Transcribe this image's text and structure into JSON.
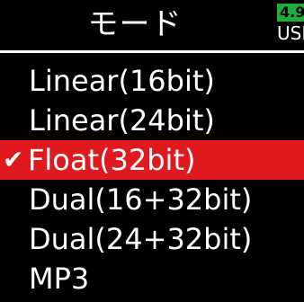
{
  "header": {
    "title": "モード",
    "battery_level": "4.9",
    "power_source": "USB"
  },
  "menu": {
    "items": [
      {
        "label": "Linear(16bit)",
        "selected": false
      },
      {
        "label": "Linear(24bit)",
        "selected": false
      },
      {
        "label": "Float(32bit)",
        "selected": true
      },
      {
        "label": "Dual(16+32bit)",
        "selected": false
      },
      {
        "label": "Dual(24+32bit)",
        "selected": false
      },
      {
        "label": "MP3",
        "selected": false
      }
    ],
    "check_glyph": "✔"
  },
  "colors": {
    "background": "#000000",
    "text": "#ffffff",
    "selection": "#e0191e",
    "battery": "#1fae3c"
  }
}
